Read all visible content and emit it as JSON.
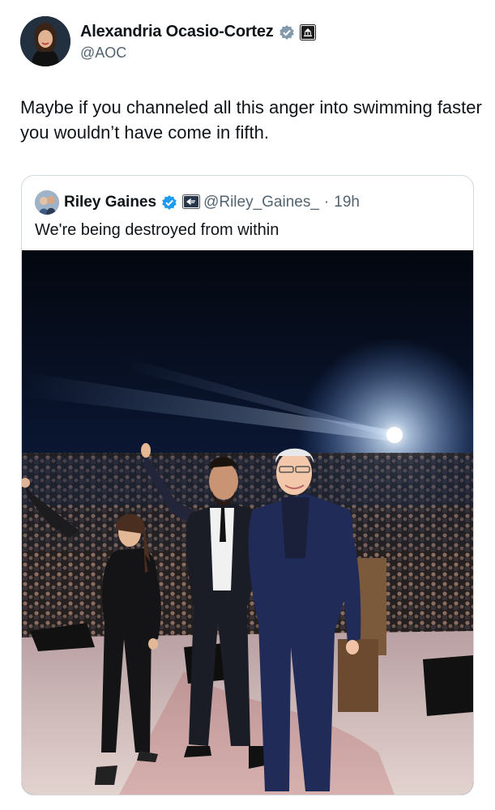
{
  "tweet": {
    "author_name": "Alexandria Ocasio-Cortez",
    "author_handle": "@AOC",
    "text": "Maybe if you channeled all this anger into swimming faster you wouldn’t have come in fifth.",
    "badges": [
      "verified-badge-gray",
      "government-affiliation-icon"
    ]
  },
  "quote": {
    "author_name": "Riley Gaines",
    "author_handle": "@Riley_Gaines_",
    "separator": "·",
    "time": "19h",
    "text": "We're being destroyed from within",
    "badges": [
      "verified-badge-blue",
      "affiliation-icon"
    ],
    "image": {
      "description_icon": "rally-stage-photo",
      "colors": {
        "sky": "#0a1430",
        "stage": "#c9b3b3",
        "light": "#ffffff"
      }
    }
  }
}
